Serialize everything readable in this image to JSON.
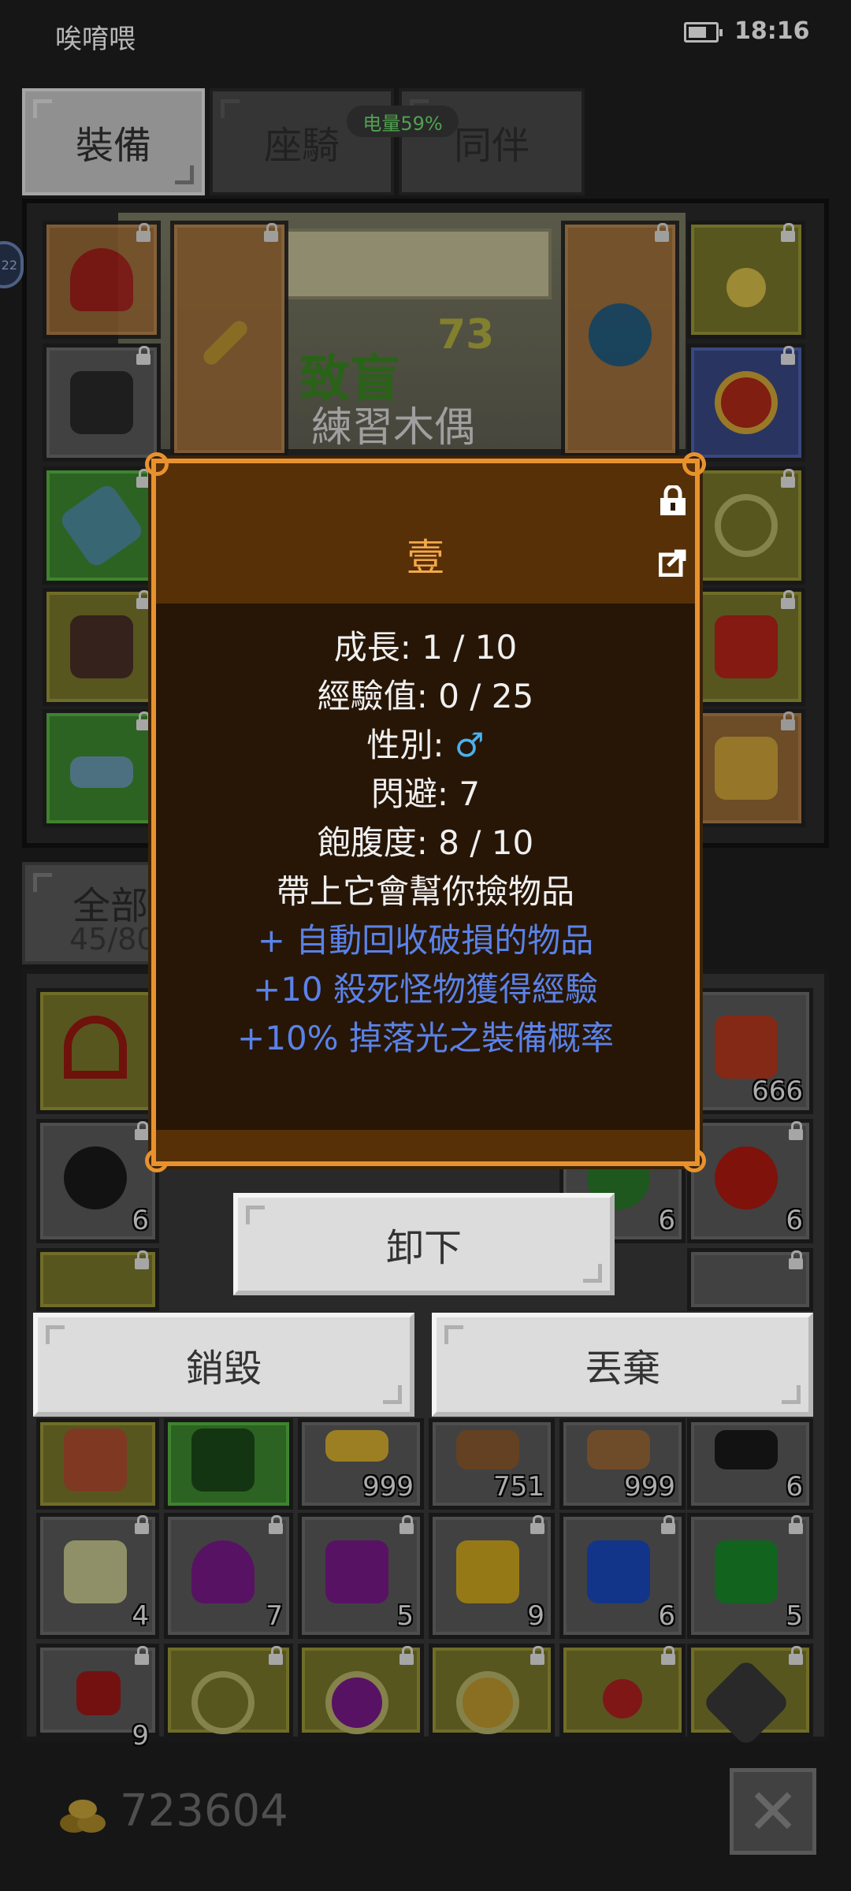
{
  "status_bar": {
    "carrier": "唉唷喂",
    "time": "18:16"
  },
  "tabs": [
    {
      "label": "裝備",
      "active": true
    },
    {
      "label": "座騎",
      "active": false
    },
    {
      "label": "同伴",
      "active": false
    }
  ],
  "battery_pill": "电量59%",
  "scene": {
    "effect_text": "致盲",
    "level": "73",
    "target_name": "練習木偶"
  },
  "side_badge": "22",
  "filter": {
    "label": "全部",
    "count": "45/80"
  },
  "inventory": {
    "counts": [
      "666",
      "6",
      "6",
      "6",
      "999",
      "751",
      "999",
      "6",
      "4",
      "7",
      "5",
      "9",
      "6",
      "5",
      "9"
    ]
  },
  "dialog": {
    "title": "壹",
    "stats": [
      "成長: 1 / 10",
      "經驗值: 0 / 25",
      "性別:",
      "閃避: 7",
      "飽腹度: 8 / 10",
      "帶上它會幫你撿物品"
    ],
    "gender_symbol": "♂",
    "bonuses": [
      "+ 自動回收破損的物品",
      "+10 殺死怪物獲得經驗",
      "+10% 掉落光之裝備概率"
    ]
  },
  "actions": {
    "unequip": "卸下",
    "destroy": "銷毀",
    "discard": "丟棄"
  },
  "gold": "723604",
  "colors": {
    "dialog_border": "#e8922e",
    "dialog_title": "#f3a84a",
    "bonus_text": "#5a82e8",
    "male": "#4ab1f0"
  }
}
